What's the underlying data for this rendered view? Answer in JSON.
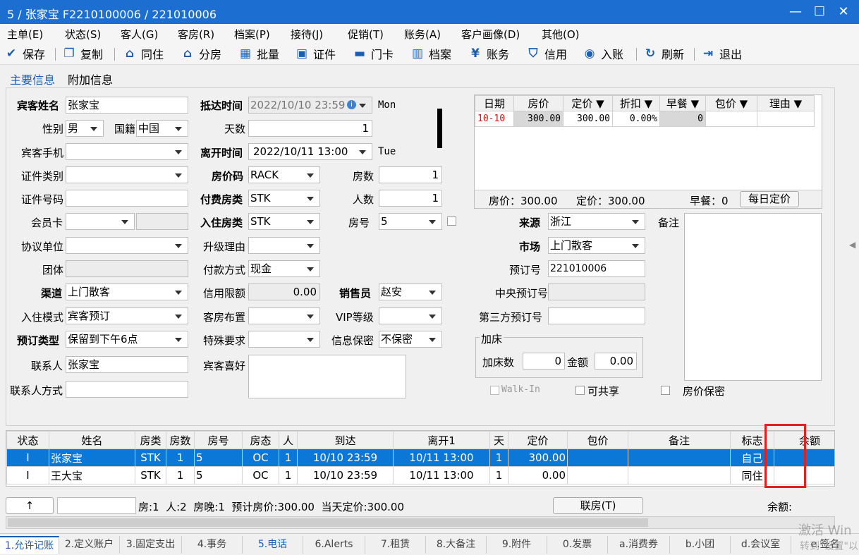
{
  "window": {
    "title": "5 / 张家宝  F2210100006  / 221010006"
  },
  "menu": [
    "主单(E)",
    "状态(S)",
    "客人(G)",
    "客房(R)",
    "档案(P)",
    "接待(J)",
    "促销(T)",
    "账务(A)",
    "客户画像(D)",
    "其他(O)"
  ],
  "toolbar": {
    "save": "保存",
    "copy": "复制",
    "share": "同住",
    "split": "分房",
    "batch": "批量",
    "cert": "证件",
    "card": "门卡",
    "archive": "档案",
    "account": "账务",
    "credit": "信用",
    "entry": "入账",
    "refresh": "刷新",
    "exit": "退出"
  },
  "tabs": {
    "main": "主要信息",
    "extra": "附加信息"
  },
  "form": {
    "guest_name_label": "宾客姓名",
    "guest_name": "张家宝",
    "gender_label": "性别",
    "gender": "男",
    "nation_label": "国籍",
    "nation": "中国",
    "phone_label": "宾客手机",
    "phone": "",
    "cert_type_label": "证件类别",
    "cert_type": "",
    "cert_no_label": "证件号码",
    "cert_no": "",
    "member_label": "会员卡",
    "member": "",
    "agreement_label": "协议单位",
    "agreement": "",
    "group_label": "团体",
    "group": "",
    "channel_label": "渠道",
    "channel": "上门散客",
    "checkin_mode_label": "入住模式",
    "checkin_mode": "宾客预订",
    "booking_type_label": "预订类型",
    "booking_type": "保留到下午6点",
    "contact_label": "联系人",
    "contact": "张家宝",
    "contact_way_label": "联系人方式",
    "contact_way": "",
    "arrival_label": "抵达时间",
    "arrival": "2022/10/10 23:59",
    "arrival_day": "Mon",
    "days_label": "天数",
    "days": "1",
    "depart_label": "离开时间",
    "depart": "2022/10/11 13:00",
    "depart_day": "Tue",
    "rate_code_label": "房价码",
    "rate_code": "RACK",
    "rooms_label": "房数",
    "rooms": "1",
    "pay_room_label": "付费房类",
    "pay_room": "STK",
    "persons_label": "人数",
    "persons": "1",
    "stay_room_label": "入住房类",
    "stay_room": "STK",
    "room_no_label": "房号",
    "room_no": "5",
    "upgrade_label": "升级理由",
    "upgrade": "",
    "pay_method_label": "付款方式",
    "pay_method": "现金",
    "credit_label": "信用限额",
    "credit": "0.00",
    "seller_label": "销售员",
    "seller": "赵安",
    "layout_label": "客房布置",
    "layout": "",
    "vip_label": "VIP等级",
    "vip": "",
    "special_label": "特殊要求",
    "special": "",
    "privacy_label": "信息保密",
    "privacy": "不保密",
    "pref_label": "宾客喜好",
    "pref": "",
    "source_label": "来源",
    "source": "浙江",
    "market_label": "市场",
    "market": "上门散客",
    "booking_no_label": "预订号",
    "booking_no": "221010006",
    "central_label": "中央预订号",
    "central": "",
    "third_label": "第三方预订号",
    "third": "",
    "note_label": "备注",
    "note": "",
    "extra_bed_title": "加床",
    "extra_bed_count_label": "加床数",
    "extra_bed_count": "0",
    "amount_label": "金额",
    "amount": "0.00",
    "walkin": "Walk-In",
    "shareable": "可共享",
    "price_secret": "房价保密"
  },
  "rate_table": {
    "headers": [
      "日期",
      "房价",
      "定价 ▼",
      "折扣 ▼",
      "早餐 ▼",
      "包价 ▼",
      "理由 ▼"
    ],
    "rows": [
      [
        "10-10",
        "300.00",
        "300.00",
        "0.00%",
        "0",
        "",
        ""
      ]
    ],
    "summary_price": "房价：300.00",
    "summary_set": "定价：300.00",
    "summary_bf": "早餐：0",
    "daily_btn": "每日定价"
  },
  "grid": {
    "headers": [
      "状态",
      "姓名",
      "房类",
      "房数",
      "房号",
      "房态",
      "人",
      "到达",
      "离开1",
      "天",
      "定价",
      "包价",
      "备注",
      "标志",
      "余额"
    ],
    "rows": [
      [
        "I",
        "张家宝",
        "STK",
        "1",
        "5",
        "OC",
        "1",
        "10/10 23:59",
        "10/11 13:00",
        "1",
        "300.00",
        "",
        "",
        "自己",
        ""
      ],
      [
        "I",
        "王大宝",
        "STK",
        "1",
        "5",
        "OC",
        "1",
        "10/10 23:59",
        "10/11 13:00",
        "1",
        "0.00",
        "",
        "",
        "同住",
        ""
      ]
    ]
  },
  "footer": {
    "arrow": "↑",
    "summary": "房:1  人:2  房晚:1  预计房价:300.00  当天定价:300.00",
    "link_btn": "联房(T)",
    "balance": "余额:"
  },
  "bottom_tabs": [
    "1.允许记账",
    "2.定义账户",
    "3.固定支出",
    "4.事务",
    "5.电话",
    "6.Alerts",
    "7.租赁",
    "8.大备注",
    "9.附件",
    "0.发票",
    "a.消费券",
    "b.小团",
    "d.会议室",
    "e.签名"
  ],
  "watermark": {
    "line1": "激活 Win",
    "line2": "转到\"设置\"以"
  }
}
